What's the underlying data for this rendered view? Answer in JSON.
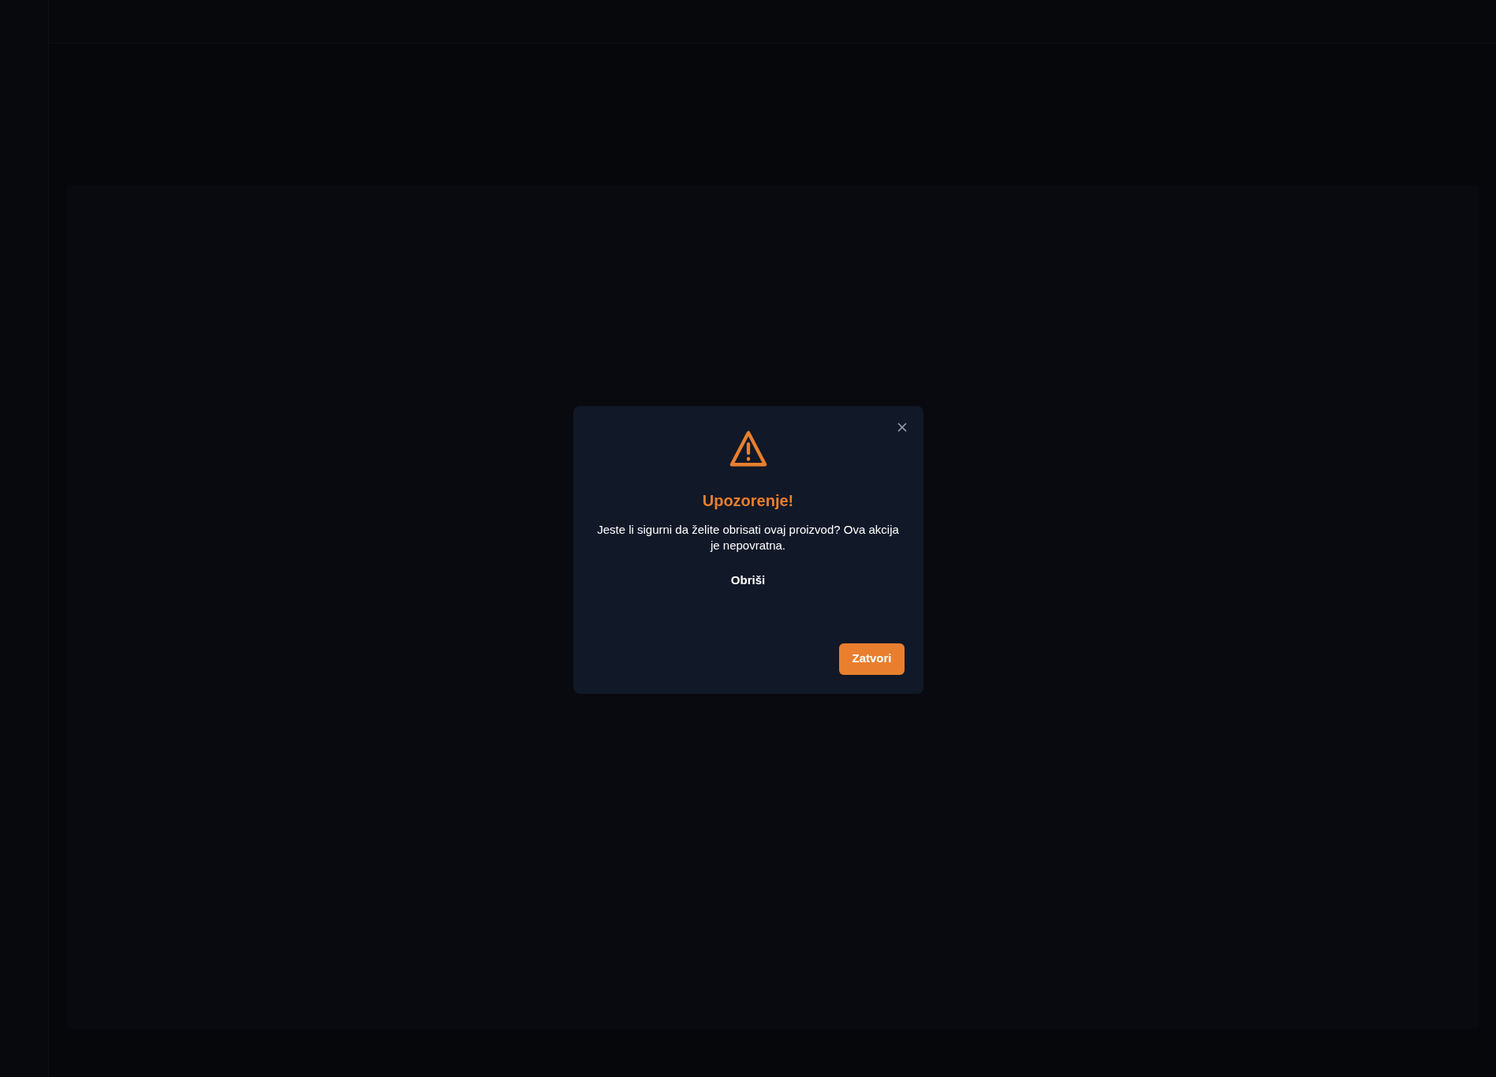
{
  "dialog": {
    "title": "Upozorenje!",
    "message": "Jeste li sigurni da želite obrisati ovaj proizvod? Ova akcija je nepovratna.",
    "confirm_label": "Obriši",
    "close_label": "Zatvori"
  }
}
